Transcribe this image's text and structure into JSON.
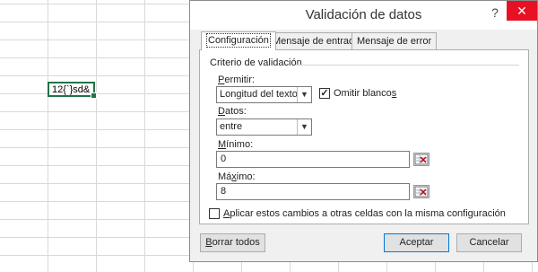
{
  "sheet": {
    "active_cell_value": "12{`}sd&"
  },
  "dialog": {
    "title": "Validación de datos",
    "help_label": "?",
    "close_label": "✕",
    "tabs": [
      {
        "label": "Configuración",
        "active": true
      },
      {
        "label": "Mensaje de entrada",
        "active": false
      },
      {
        "label": "Mensaje de error",
        "active": false
      }
    ],
    "group_label": "Criterio de validación",
    "permitir": {
      "label_u": "P",
      "label_rest": "ermitir:",
      "value": "Longitud del texto"
    },
    "omitir_blancos": {
      "label_pre": "Omitir blanco",
      "label_u": "s",
      "checked": true,
      "mark": "✓"
    },
    "datos": {
      "label_u": "D",
      "label_rest": "atos:",
      "value": "entre"
    },
    "minimo": {
      "label_u": "M",
      "label_rest": "ínimo:",
      "value": "0"
    },
    "maximo": {
      "label_pre": "Má",
      "label_u": "x",
      "label_rest": "imo:",
      "value": "8"
    },
    "apply_all": {
      "label_u": "A",
      "label_rest": "plicar estos cambios a otras celdas con la misma configuración",
      "checked": false
    },
    "buttons": {
      "clear_u": "B",
      "clear_rest": "orrar todos",
      "accept": "Aceptar",
      "cancel": "Cancelar"
    },
    "colors": {
      "close_bg": "#e81123",
      "accent": "#0078d7",
      "cell_border": "#217346"
    }
  }
}
